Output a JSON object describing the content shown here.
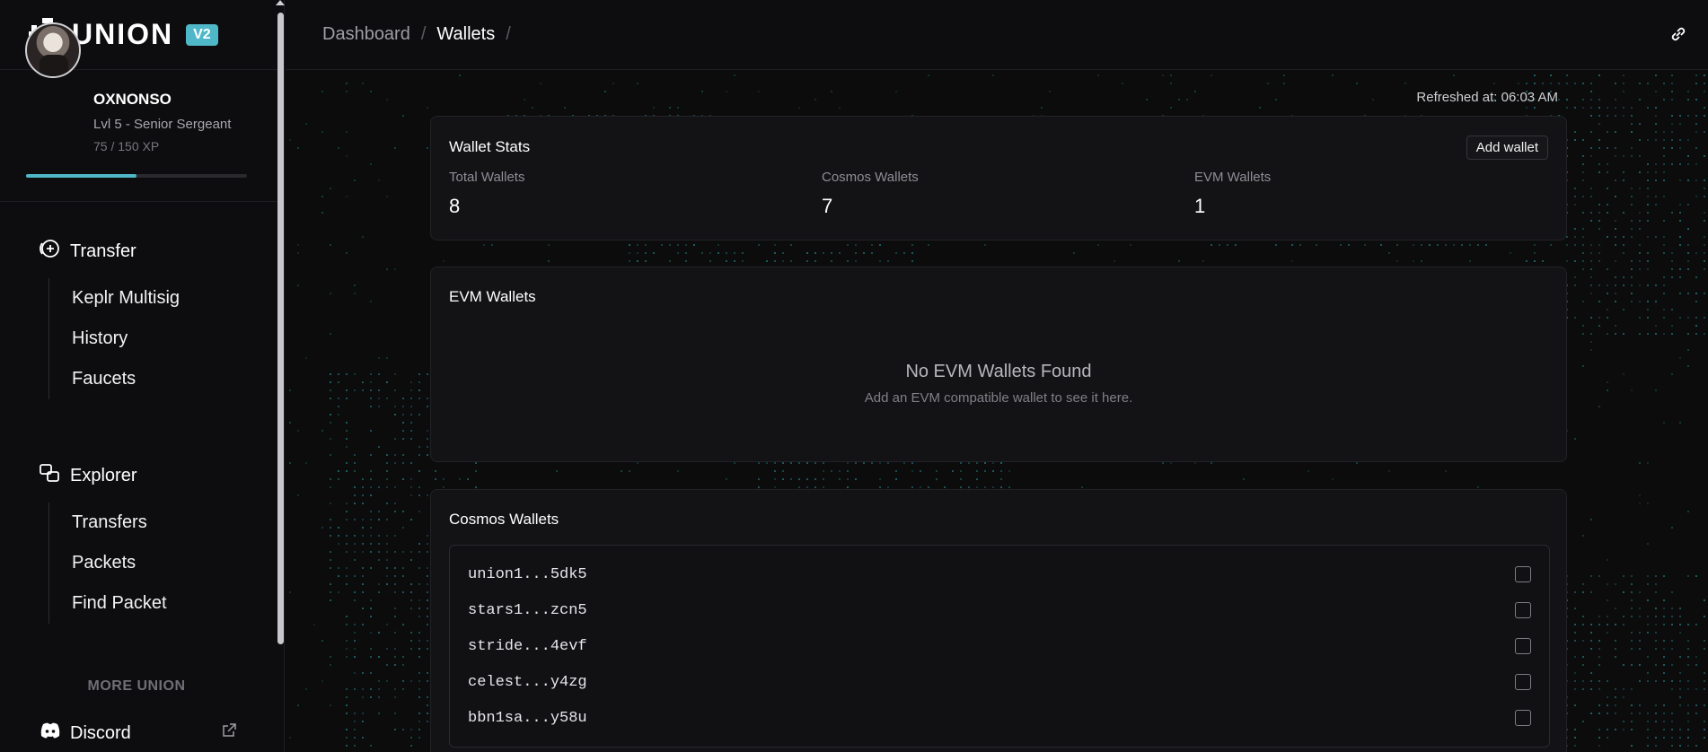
{
  "brand": {
    "name": "UNION",
    "badge": "V2"
  },
  "profile": {
    "name": "OXNONSO",
    "level": "Lvl 5 - Senior Sergeant",
    "xp": "75 / 150 XP",
    "xp_progress": 0.5
  },
  "nav": {
    "transfer": {
      "label": "Transfer",
      "items": [
        "Keplr Multisig",
        "History",
        "Faucets"
      ]
    },
    "explorer": {
      "label": "Explorer",
      "items": [
        "Transfers",
        "Packets",
        "Find Packet"
      ]
    },
    "more_label": "MORE UNION",
    "discord": "Discord"
  },
  "breadcrumb": {
    "root": "Dashboard",
    "current": "Wallets"
  },
  "refreshed": "Refreshed at: 06:03 AM",
  "stats": {
    "title": "Wallet Stats",
    "add_wallet": "Add wallet",
    "total_label": "Total Wallets",
    "total_value": "8",
    "cosmos_label": "Cosmos Wallets",
    "cosmos_value": "7",
    "evm_label": "EVM Wallets",
    "evm_value": "1"
  },
  "evm_card": {
    "title": "EVM Wallets",
    "empty_title": "No EVM Wallets Found",
    "empty_sub": "Add an EVM compatible wallet to see it here."
  },
  "cosmos_card": {
    "title": "Cosmos Wallets",
    "wallets": [
      "union1...5dk5",
      "stars1...zcn5",
      "stride...4evf",
      "celest...y4zg",
      "bbn1sa...y58u"
    ]
  },
  "colors": {
    "accent": "#4fb8c8",
    "background": "#0c0c0d",
    "card": "#131316"
  }
}
